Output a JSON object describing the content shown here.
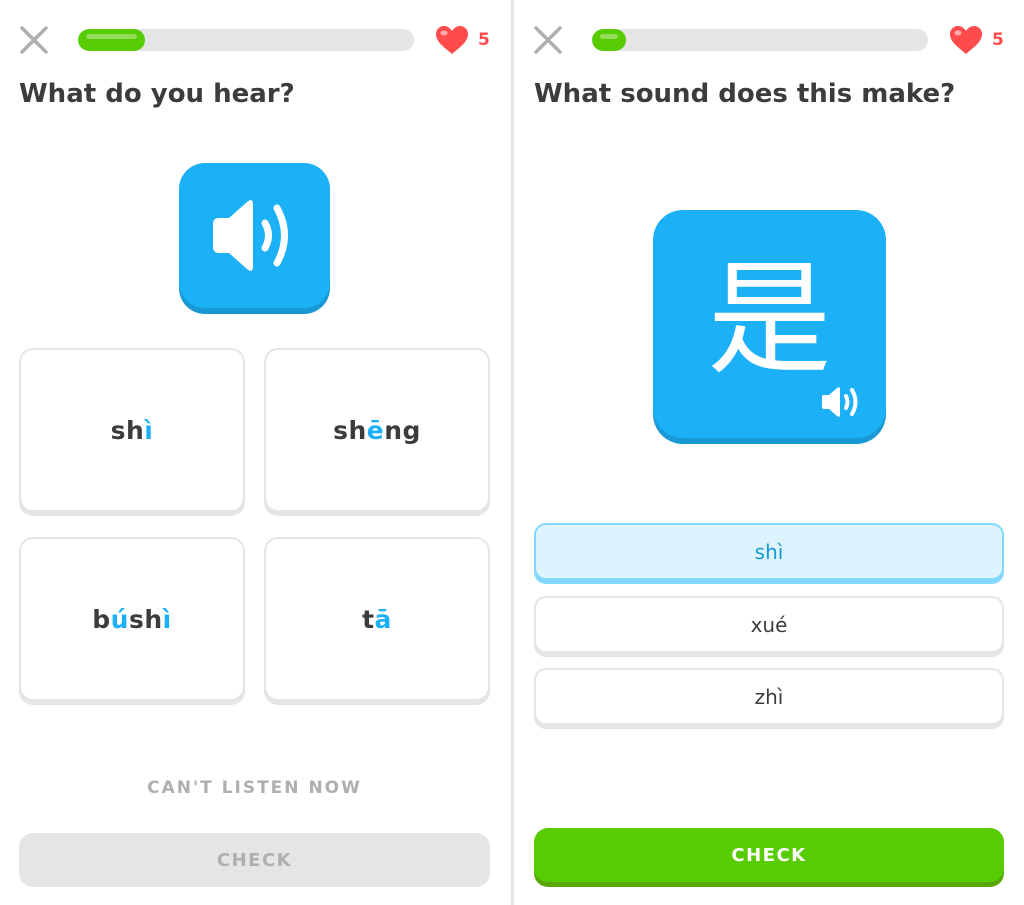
{
  "colors": {
    "brand_green": "#58cc02",
    "accent_blue": "#1cb0f6",
    "heart_red": "#ff4b4b",
    "gray": "#e5e5e5",
    "text": "#3c3c3c"
  },
  "left": {
    "progress_fraction": 0.2,
    "hearts": "5",
    "question": "What do you hear?",
    "choices": [
      {
        "parts": [
          "sh",
          "ì",
          ""
        ]
      },
      {
        "parts": [
          "sh",
          "ē",
          "ng"
        ]
      },
      {
        "parts": [
          "b",
          "ú",
          "sh",
          "ì"
        ]
      },
      {
        "parts": [
          "t",
          "ā"
        ]
      }
    ],
    "cant_listen_label": "CAN'T LISTEN NOW",
    "check_label": "CHECK",
    "check_enabled": false
  },
  "right": {
    "progress_fraction": 0.1,
    "hearts": "5",
    "question": "What sound does this make?",
    "character": "是",
    "options": [
      {
        "label": "shì",
        "selected": true
      },
      {
        "label": "xué",
        "selected": false
      },
      {
        "label": "zhì",
        "selected": false
      }
    ],
    "check_label": "CHECK",
    "check_enabled": true
  },
  "icons": {
    "close": "close-icon",
    "heart": "heart-icon",
    "speaker": "speaker-icon"
  }
}
